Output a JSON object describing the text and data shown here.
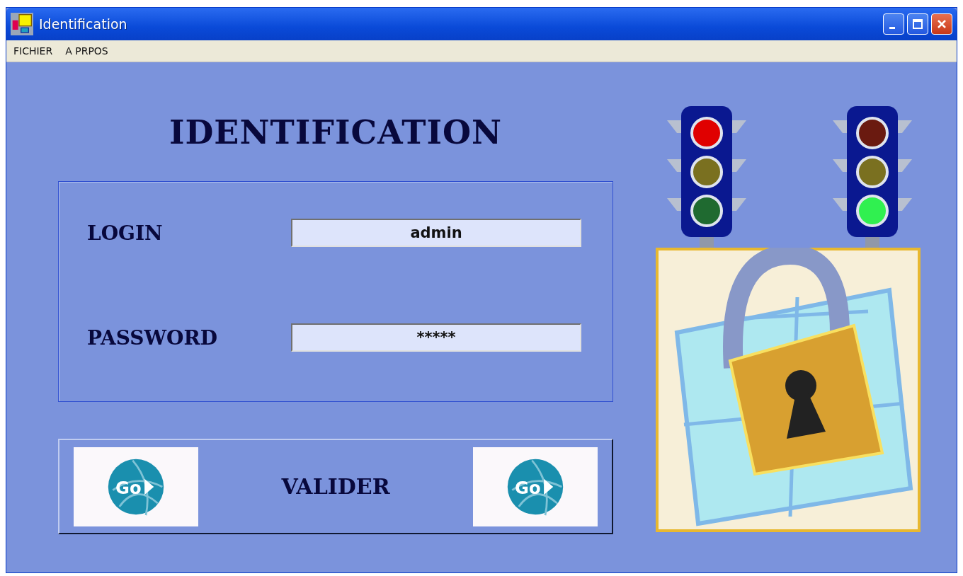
{
  "window": {
    "title": "Identification"
  },
  "menu": [
    "FICHIER",
    "A PRPOS"
  ],
  "heading": "IDENTIFICATION",
  "form": {
    "fields": [
      {
        "label": "LOGIN",
        "value": "admin"
      },
      {
        "label": "PASSWORD",
        "value": "*****"
      }
    ]
  },
  "submit": {
    "label": "VALIDER",
    "go_buttons": [
      {
        "text": "Go"
      },
      {
        "text": "Go"
      }
    ]
  },
  "traffic_lights": [
    {
      "lamps": [
        {
          "on": true
        },
        {
          "on": false
        },
        {
          "on": false
        }
      ]
    },
    {
      "lamps": [
        {
          "on": false
        },
        {
          "on": false
        },
        {
          "on": true
        }
      ]
    }
  ]
}
